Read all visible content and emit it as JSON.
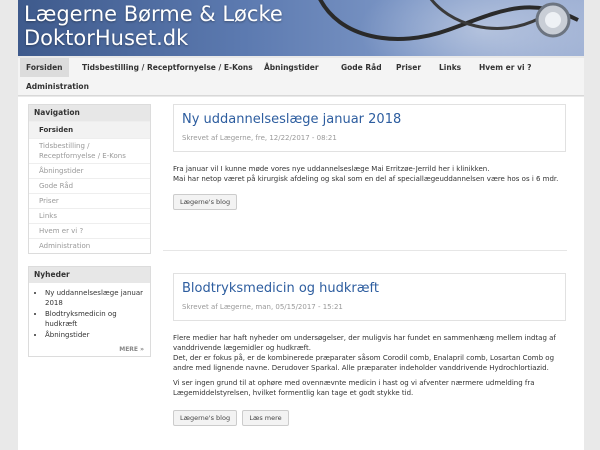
{
  "header": {
    "title_line1": "Lægerne Børme & Løcke",
    "title_line2": "DoktorHuset.dk"
  },
  "nav": {
    "items": [
      "Forsiden",
      "Tidsbestilling / Receptfornyelse / E-Kons",
      "Åbningstider",
      "Gode Råd",
      "Priser",
      "Links",
      "Hvem er vi ?",
      "Administration"
    ]
  },
  "sidebar": {
    "navigation_title": "Navigation",
    "menu": [
      "Forsiden",
      "Tidsbestilling / Receptfornyelse / E-Kons",
      "Åbningstider",
      "Gode Råd",
      "Priser",
      "Links",
      "Hvem er vi ?",
      "Administration"
    ],
    "news_title": "Nyheder",
    "news": [
      "Ny uddannelseslæge januar 2018",
      "Blodtryksmedicin og hudkræft",
      "Åbningstider"
    ],
    "more_label": "MERE »"
  },
  "posts": [
    {
      "title": "Ny uddannelseslæge januar 2018",
      "meta": "Skrevet af Lægerne, fre, 12/22/2017 - 08:21",
      "body": [
        "Fra januar vil I kunne møde vores nye uddannelseslæge Mai Erritzøe-Jerrild her i klinikken.",
        "Mai har netop været på kirurgisk afdeling og skal som en del af speciallægeuddannelsen være hos os i 6 mdr."
      ],
      "blog_label": "Lægerne's blog"
    },
    {
      "title": "Blodtryksmedicin og hudkræft",
      "meta": "Skrevet af Lægerne, man, 05/15/2017 - 15:21",
      "body": [
        "Flere medier har haft nyheder om undersøgelser, der muligvis har fundet en sammenhæng mellem indtag af vanddrivende lægemidler og hudkræft.",
        "Det, der er fokus på, er de kombinerede præparater såsom Corodil comb, Enalapril comb, Losartan Comb og andre med lignende navne. Derudover Sparkal. Alle præparater indeholder vanddrivende Hydrochlortiazid.",
        "Vi ser ingen grund til at ophøre med ovennævnte medicin i hast og vi afventer nærmere udmelding fra Lægemiddelstyrelsen, hvilket formentlig kan tage et godt stykke tid."
      ],
      "blog_label": "Lægerne's blog",
      "read_more_label": "Læs mere"
    }
  ]
}
